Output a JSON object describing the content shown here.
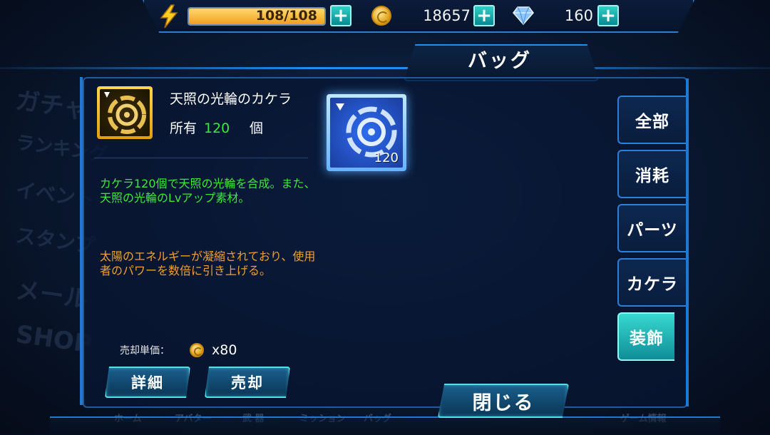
{
  "background": {
    "side_menu": [
      "ガチャ",
      "ランキング",
      "イベント",
      "スタンプ",
      "メール",
      "SHOP"
    ],
    "bottom_nav": [
      "ホーム",
      "アバター",
      "武 器",
      "ミッション",
      "バッグ",
      "ゲーム情報"
    ]
  },
  "topbar": {
    "energy": "108/108",
    "energy_fraction": 1.0,
    "coins": "18657",
    "gems": "160",
    "plus": "+"
  },
  "header": {
    "title": "バッグ"
  },
  "item": {
    "name": "天照の光輪のカケラ",
    "owned_label": "所有",
    "owned_count": "120",
    "owned_unit": "個",
    "desc_green": "カケラ120個で天照の光輪を合成。また、天照の光輪のLvアップ素材。",
    "desc_orange": "太陽のエネルギーが凝縮されており、使用者のパワーを数倍に引き上げる。",
    "sell_label": "売却単価：",
    "sell_price": "x80"
  },
  "buttons": {
    "detail": "詳細",
    "sell": "売却",
    "close": "閉じる"
  },
  "grid": [
    {
      "quantity": "120"
    }
  ],
  "categories": [
    "全部",
    "消耗",
    "パーツ",
    "カケラ",
    "装飾"
  ],
  "active_category": "装飾",
  "colors": {
    "accent": "#2b7fd8",
    "highlight": "#38d8d0",
    "green_text": "#3de83d",
    "orange_text": "#f0a030"
  }
}
